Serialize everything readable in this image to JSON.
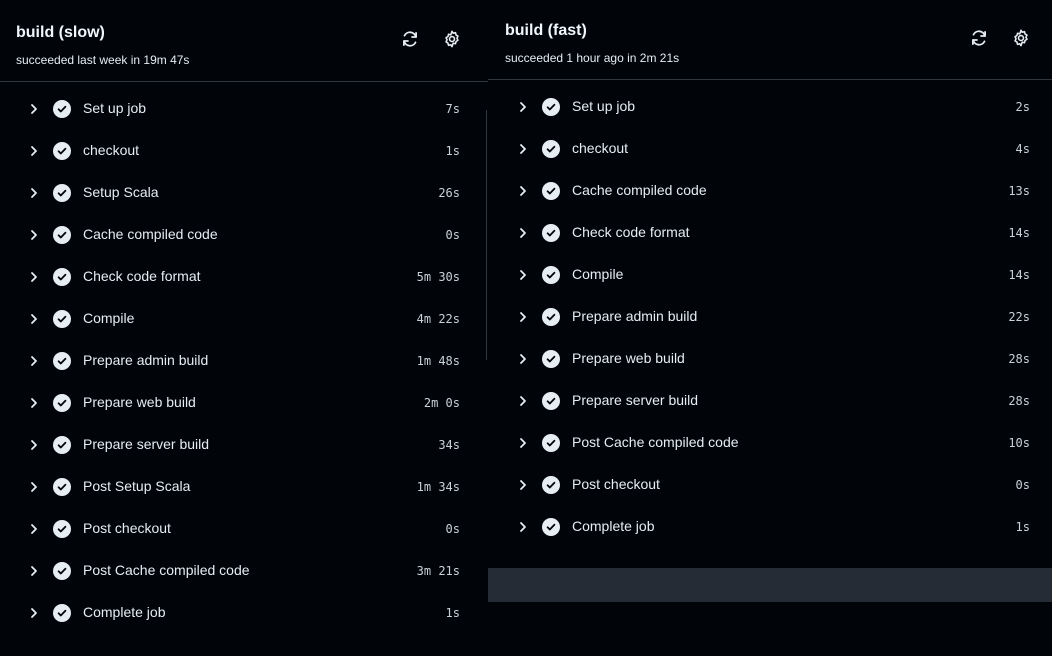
{
  "left": {
    "title": "build (slow)",
    "subtitle": "succeeded last week in 19m 47s",
    "refresh_icon": "refresh-icon",
    "settings_icon": "gear-icon",
    "steps": [
      {
        "label": "Set up job",
        "duration": "7s"
      },
      {
        "label": "checkout",
        "duration": "1s"
      },
      {
        "label": "Setup Scala",
        "duration": "26s"
      },
      {
        "label": "Cache compiled code",
        "duration": "0s"
      },
      {
        "label": "Check code format",
        "duration": "5m 30s"
      },
      {
        "label": "Compile",
        "duration": "4m 22s"
      },
      {
        "label": "Prepare admin build",
        "duration": "1m 48s"
      },
      {
        "label": "Prepare web build",
        "duration": "2m 0s"
      },
      {
        "label": "Prepare server build",
        "duration": "34s"
      },
      {
        "label": "Post Setup Scala",
        "duration": "1m 34s"
      },
      {
        "label": "Post checkout",
        "duration": "0s"
      },
      {
        "label": "Post Cache compiled code",
        "duration": "3m 21s"
      },
      {
        "label": "Complete job",
        "duration": "1s"
      }
    ]
  },
  "right": {
    "title": "build (fast)",
    "subtitle": "succeeded 1 hour ago in 2m 21s",
    "refresh_icon": "refresh-icon",
    "settings_icon": "gear-icon",
    "steps": [
      {
        "label": "Set up job",
        "duration": "2s"
      },
      {
        "label": "checkout",
        "duration": "4s"
      },
      {
        "label": "Cache compiled code",
        "duration": "13s"
      },
      {
        "label": "Check code format",
        "duration": "14s"
      },
      {
        "label": "Compile",
        "duration": "14s"
      },
      {
        "label": "Prepare admin build",
        "duration": "22s"
      },
      {
        "label": "Prepare web build",
        "duration": "28s"
      },
      {
        "label": "Prepare server build",
        "duration": "28s"
      },
      {
        "label": "Post Cache compiled code",
        "duration": "10s"
      },
      {
        "label": "Post checkout",
        "duration": "0s"
      },
      {
        "label": "Complete job",
        "duration": "1s"
      }
    ]
  },
  "colors": {
    "background": "#010409",
    "text": "#e6edf3",
    "border": "#30363d",
    "footer": "#262c36"
  }
}
